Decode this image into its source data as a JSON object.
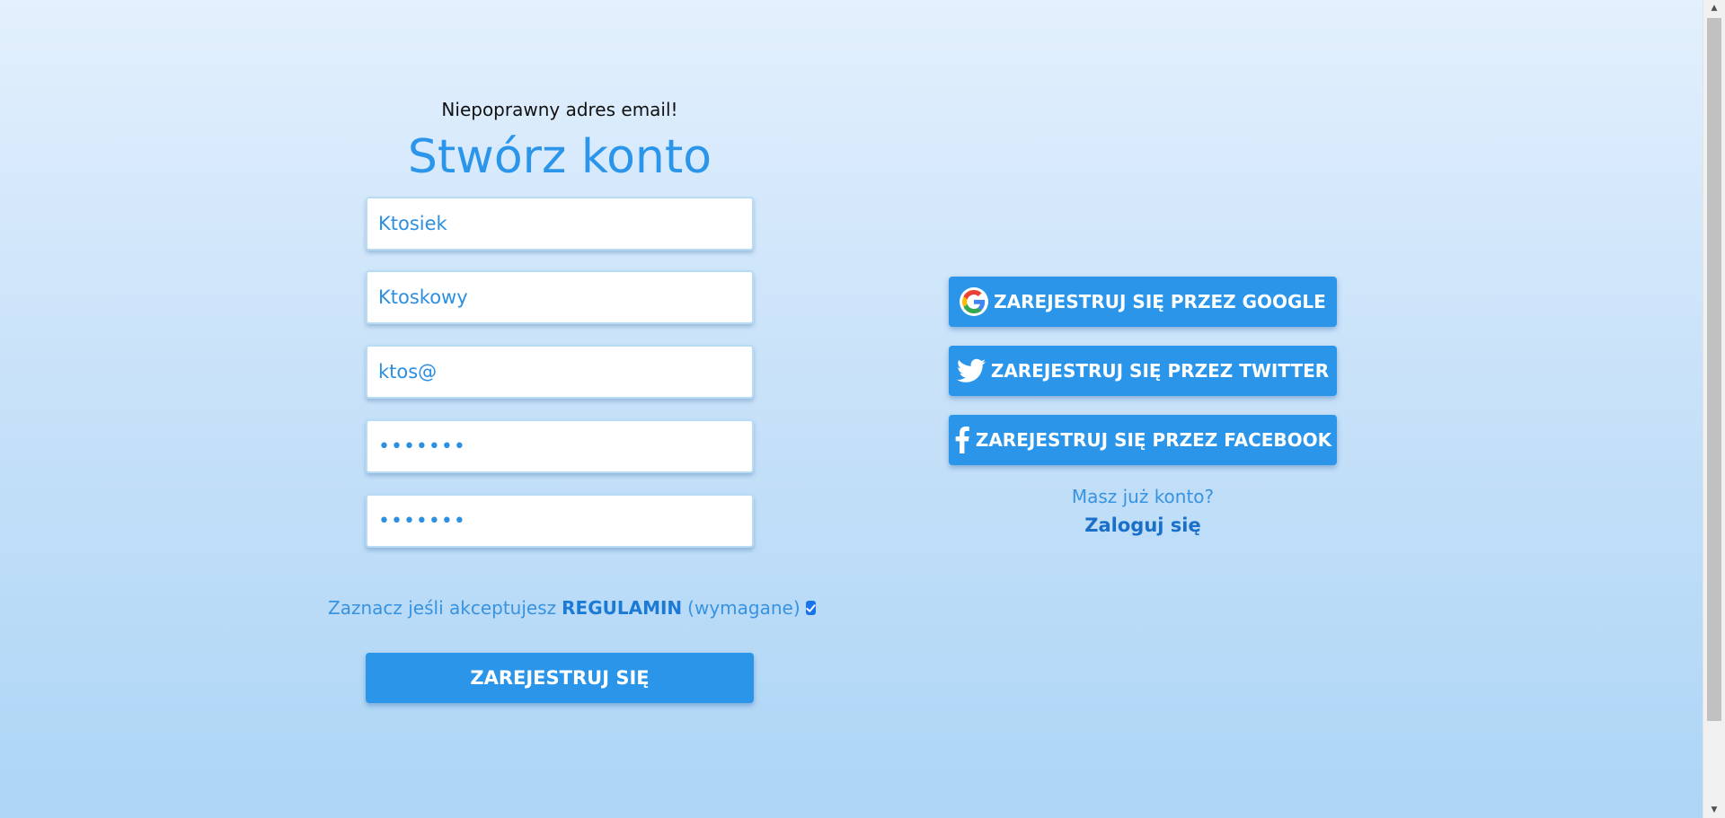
{
  "form": {
    "error_message": "Niepoprawny adres email!",
    "title": "Stwórz konto",
    "fields": {
      "first_name": "Ktosiek",
      "last_name": "Ktoskowy",
      "email": "ktos@",
      "password": "•••••••",
      "password_confirm": "•••••••"
    },
    "terms": {
      "prefix": "Zaznacz jeśli akceptujesz",
      "link": "REGULAMIN",
      "suffix": "(wymagane)",
      "checked": true
    },
    "submit_label": "ZAREJESTRUJ SIĘ"
  },
  "social": {
    "google_label": "ZAREJESTRUJ SIĘ PRZEZ GOOGLE",
    "twitter_label": "ZAREJESTRUJ SIĘ PRZEZ TWITTER",
    "facebook_label": "ZAREJESTRUJ SIĘ PRZEZ FACEBOOK",
    "icons": [
      "google-icon",
      "twitter-icon",
      "facebook-icon"
    ]
  },
  "login": {
    "prompt": "Masz już konto?",
    "link": "Zaloguj się"
  },
  "colors": {
    "accent": "#2b95ea",
    "link": "#1a6fc8",
    "text_blue": "#3793e0"
  }
}
